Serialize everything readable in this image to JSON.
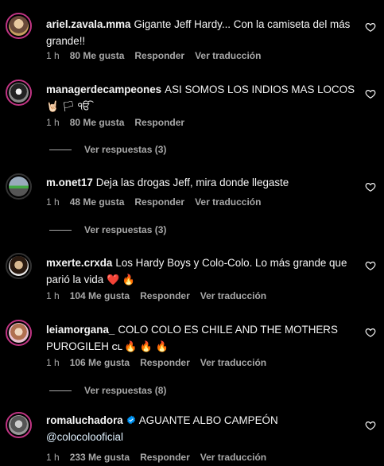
{
  "comments": [
    {
      "username": "ariel.zavala.mma",
      "text": "Gigante Jeff Hardy... Con la camiseta del más grande!!",
      "time": "1 h",
      "likes": "80 Me gusta",
      "reply": "Responder",
      "translate": "Ver traducción"
    },
    {
      "username": "managerdecampeones",
      "text": "ASI SOMOS LOS INDIOS MAS LOCOS",
      "text_line2": "🤘🏻 🏳 ੴ",
      "time": "1 h",
      "likes": "80 Me gusta",
      "reply": "Responder",
      "replies_label": "Ver respuestas (3)"
    },
    {
      "username": "m.onet17",
      "text": "Deja las drogas Jeff, mira donde llegaste",
      "time": "1 h",
      "likes": "48 Me gusta",
      "reply": "Responder",
      "translate": "Ver traducción",
      "replies_label": "Ver respuestas (3)"
    },
    {
      "username": "mxerte.crxda",
      "text": "Los Hardy Boys y Colo-Colo. Lo más grande que parió la vida",
      "emojis": "❤️ 🔥",
      "time": "1 h",
      "likes": "104 Me gusta",
      "reply": "Responder",
      "translate": "Ver traducción"
    },
    {
      "username": "leiamorgana_",
      "text": "COLO COLO ES CHILE AND THE MOTHERS PUROGILEH",
      "flag": "CL",
      "emojis": "🔥 🔥 🔥",
      "time": "1 h",
      "likes": "106 Me gusta",
      "reply": "Responder",
      "translate": "Ver traducción",
      "replies_label": "Ver respuestas (8)"
    },
    {
      "username": "romaluchadora",
      "text": "AGUANTE ALBO CAMPEÓN",
      "mention": "@colocolooficial",
      "time": "1 h",
      "likes": "233 Me gusta",
      "reply": "Responder",
      "translate": "Ver traducción"
    }
  ],
  "colors": {
    "background": "#000000",
    "text": "#f5f5f5",
    "secondary": "#a8a8a8",
    "verified": "#0095f6",
    "story_ring": "#c13584"
  },
  "icons": [
    "heart-icon",
    "verified-badge-icon"
  ]
}
